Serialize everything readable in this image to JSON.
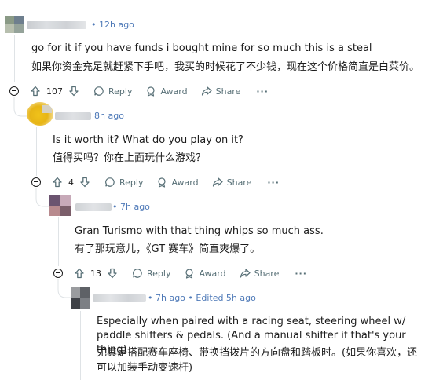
{
  "comments": [
    {
      "id": "c1",
      "time": "• 12h ago",
      "text_en": "go for it if you have funds i bought mine for so much this is a steal",
      "text_zh": "如果你资金充足就赶紧下手吧，我买的时候花了不少钱，现在这个价格简直是白菜价。",
      "votes": "107",
      "reply": "Reply",
      "award": "Award",
      "share": "Share",
      "more": "···"
    },
    {
      "id": "c2",
      "time": "8h ago",
      "text_en": "Is it worth it? What do you play on it?",
      "text_zh": "值得买吗？你在上面玩什么游戏？",
      "votes": "4",
      "reply": "Reply",
      "award": "Award",
      "share": "Share",
      "more": "···"
    },
    {
      "id": "c3",
      "time": "• 7h ago",
      "text_en": "Gran Turismo with that thing whips so much ass.",
      "text_zh": "有了那玩意儿，《GT 赛车》简直爽爆了。",
      "votes": "13",
      "reply": "Reply",
      "award": "Award",
      "share": "Share",
      "more": "···"
    },
    {
      "id": "c4",
      "time": "• 7h ago • Edited 5h ago",
      "text_en": "Especially when paired with a racing seat, steering wheel w/ paddle shifters & pedals. (And a manual shifter if that's your thing)",
      "text_zh": "尤其是搭配赛车座椅、带换挡拨片的方向盘和踏板时。(如果你喜欢，还可以加装手动变速杆)"
    }
  ]
}
